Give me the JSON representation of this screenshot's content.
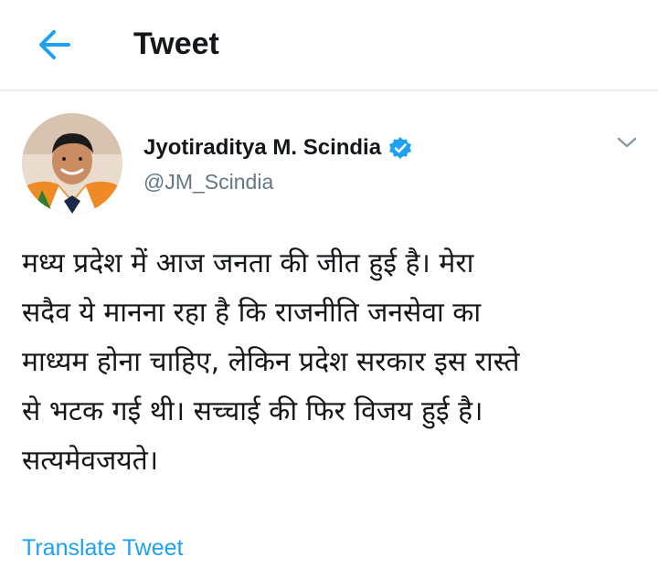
{
  "header": {
    "back_icon": "arrow-left-icon",
    "title": "Tweet"
  },
  "tweet": {
    "author": {
      "name": "Jyotiraditya M. Scindia",
      "handle": "@JM_Scindia",
      "verified": true,
      "verified_icon": "verified-badge-icon"
    },
    "menu_icon": "chevron-down-icon",
    "text": "मध्य प्रदेश में आज जनता की जीत हुई है। मेरा\nसदैव ये मानना रहा है कि राजनीति जनसेवा का\nमाध्यम होना चाहिए, लेकिन प्रदेश सरकार इस रास्ते\nसे भटक गई थी। सच्चाई की फिर विजय हुई है।\nसत्यमेवजयते।",
    "translate_label": "Translate Tweet"
  },
  "colors": {
    "accent": "#1da1f2",
    "text_primary": "#14171a",
    "text_secondary": "#657786",
    "divider": "#e6ecf0"
  }
}
